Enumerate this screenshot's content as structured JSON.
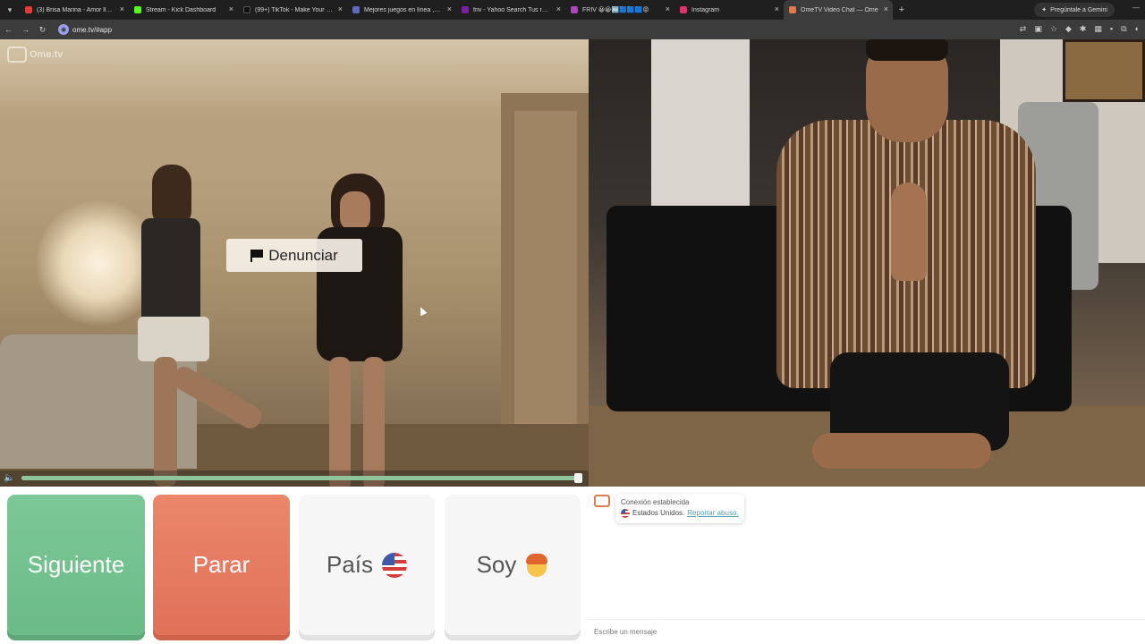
{
  "browser": {
    "tabs": [
      {
        "title": "(3) Brisa Marina - Amor llegal 2",
        "favicon_color": "#e53935"
      },
      {
        "title": "Stream - Kick Dashboard",
        "favicon_color": "#53fc18"
      },
      {
        "title": "(99+) TikTok - Make Your Day",
        "favicon_color": "#111111"
      },
      {
        "title": "Mejores juegos en línea , Juegos",
        "favicon_color": "#5c6bc0"
      },
      {
        "title": "friv - Yahoo Search Tus resultados",
        "favicon_color": "#7b1fa2"
      },
      {
        "title": "FRIV 😀😀🔤🟦🟦🟦😡",
        "favicon_color": "#ab47bc"
      },
      {
        "title": "Instagram",
        "favicon_color": "#e1306c"
      },
      {
        "title": "OmeTV Video Chat — Ome",
        "favicon_color": "#e07a4f"
      }
    ],
    "new_tab": "+",
    "gemini_button": "Pregúntale a Gemini",
    "url": "ome.tv/#app"
  },
  "app": {
    "logo": "Ome.tv",
    "report_button": "Denunciar",
    "buttons": {
      "next": "Siguiente",
      "stop": "Parar",
      "country": "País",
      "gender": "Soy"
    },
    "volume_level": 0.99
  },
  "chat": {
    "status": "Conexión establecida",
    "country": "Estados Unidos.",
    "report_link": "Reportar abuso.",
    "input_placeholder": "Escribe un mensaje"
  },
  "icons": {
    "country_flag": "us-flag-icon",
    "gender": "boy-emoji-icon"
  }
}
